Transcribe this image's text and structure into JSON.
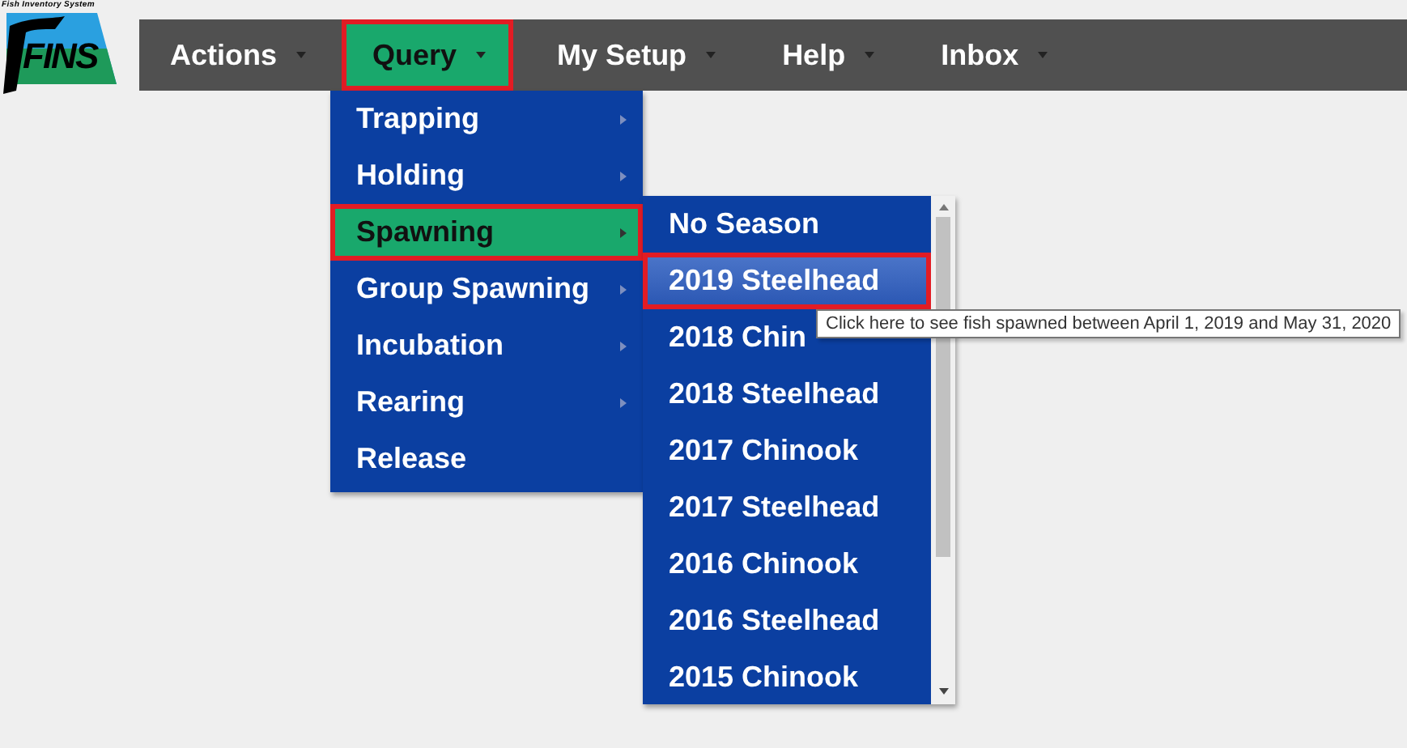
{
  "logo": {
    "caption": "Fish Inventory System",
    "letters": "FINS"
  },
  "menu_bar": [
    {
      "label": "Actions",
      "selected": false
    },
    {
      "label": "Query",
      "selected": true
    },
    {
      "label": "My Setup",
      "selected": false
    },
    {
      "label": "Help",
      "selected": false
    },
    {
      "label": "Inbox",
      "selected": false
    }
  ],
  "query_menu": [
    {
      "label": "Trapping",
      "selected": false,
      "has_submenu": true
    },
    {
      "label": "Holding",
      "selected": false,
      "has_submenu": true
    },
    {
      "label": "Spawning",
      "selected": true,
      "has_submenu": true
    },
    {
      "label": "Group Spawning",
      "selected": false,
      "has_submenu": true
    },
    {
      "label": "Incubation",
      "selected": false,
      "has_submenu": true
    },
    {
      "label": "Rearing",
      "selected": false,
      "has_submenu": true
    },
    {
      "label": "Release",
      "selected": false,
      "has_submenu": false
    }
  ],
  "spawning_menu": [
    {
      "label": "No Season",
      "selected": false
    },
    {
      "label": "2019 Steelhead",
      "selected": true
    },
    {
      "label": "2018 Chin",
      "selected": false
    },
    {
      "label": "2018 Steelhead",
      "selected": false
    },
    {
      "label": "2017 Chinook",
      "selected": false
    },
    {
      "label": "2017 Steelhead",
      "selected": false
    },
    {
      "label": "2016 Chinook",
      "selected": false
    },
    {
      "label": "2016 Steelhead",
      "selected": false
    },
    {
      "label": "2015 Chinook",
      "selected": false
    }
  ],
  "tooltip": "Click here to see fish spawned between April 1, 2019 and May 31, 2020"
}
